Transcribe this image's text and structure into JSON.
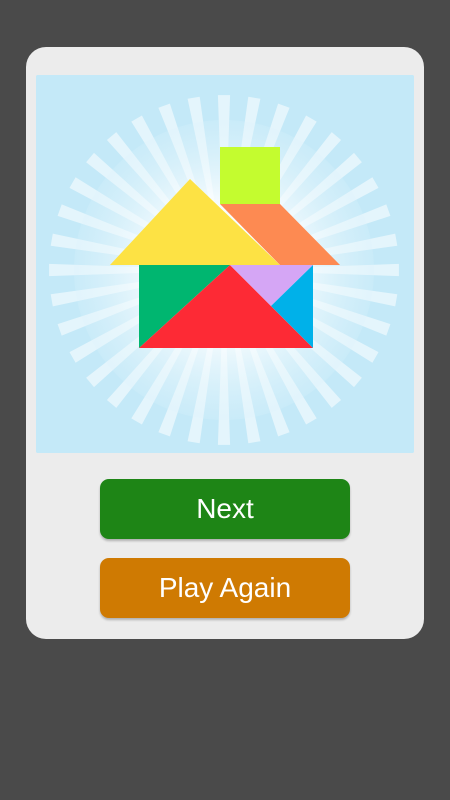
{
  "puzzle": {
    "name": "",
    "pieces": [
      {
        "name": "square",
        "color": "#c4fc2f"
      },
      {
        "name": "parallelogram",
        "color": "#fd8a52"
      },
      {
        "name": "large-triangle-yellow",
        "color": "#fde244"
      },
      {
        "name": "medium-triangle-green",
        "color": "#00b670"
      },
      {
        "name": "large-triangle-red",
        "color": "#fd2a35"
      },
      {
        "name": "small-triangle-purple",
        "color": "#d5a6f5"
      },
      {
        "name": "small-triangle-blue",
        "color": "#00b1e9"
      }
    ],
    "background_color": "#c4e9f8"
  },
  "buttons": {
    "next_label": "Next",
    "play_again_label": "Play Again",
    "next_color": "#1e8516",
    "play_again_color": "#cf7a02"
  }
}
